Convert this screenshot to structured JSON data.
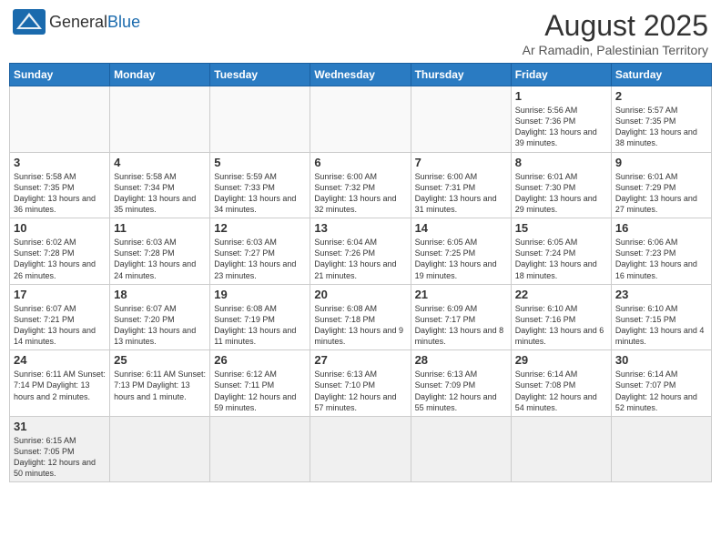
{
  "logo": {
    "text_general": "General",
    "text_blue": "Blue"
  },
  "title": "August 2025",
  "subtitle": "Ar Ramadin, Palestinian Territory",
  "weekdays": [
    "Sunday",
    "Monday",
    "Tuesday",
    "Wednesday",
    "Thursday",
    "Friday",
    "Saturday"
  ],
  "weeks": [
    [
      {
        "day": "",
        "info": ""
      },
      {
        "day": "",
        "info": ""
      },
      {
        "day": "",
        "info": ""
      },
      {
        "day": "",
        "info": ""
      },
      {
        "day": "",
        "info": ""
      },
      {
        "day": "1",
        "info": "Sunrise: 5:56 AM\nSunset: 7:36 PM\nDaylight: 13 hours and 39 minutes."
      },
      {
        "day": "2",
        "info": "Sunrise: 5:57 AM\nSunset: 7:35 PM\nDaylight: 13 hours and 38 minutes."
      }
    ],
    [
      {
        "day": "3",
        "info": "Sunrise: 5:58 AM\nSunset: 7:35 PM\nDaylight: 13 hours and 36 minutes."
      },
      {
        "day": "4",
        "info": "Sunrise: 5:58 AM\nSunset: 7:34 PM\nDaylight: 13 hours and 35 minutes."
      },
      {
        "day": "5",
        "info": "Sunrise: 5:59 AM\nSunset: 7:33 PM\nDaylight: 13 hours and 34 minutes."
      },
      {
        "day": "6",
        "info": "Sunrise: 6:00 AM\nSunset: 7:32 PM\nDaylight: 13 hours and 32 minutes."
      },
      {
        "day": "7",
        "info": "Sunrise: 6:00 AM\nSunset: 7:31 PM\nDaylight: 13 hours and 31 minutes."
      },
      {
        "day": "8",
        "info": "Sunrise: 6:01 AM\nSunset: 7:30 PM\nDaylight: 13 hours and 29 minutes."
      },
      {
        "day": "9",
        "info": "Sunrise: 6:01 AM\nSunset: 7:29 PM\nDaylight: 13 hours and 27 minutes."
      }
    ],
    [
      {
        "day": "10",
        "info": "Sunrise: 6:02 AM\nSunset: 7:28 PM\nDaylight: 13 hours and 26 minutes."
      },
      {
        "day": "11",
        "info": "Sunrise: 6:03 AM\nSunset: 7:28 PM\nDaylight: 13 hours and 24 minutes."
      },
      {
        "day": "12",
        "info": "Sunrise: 6:03 AM\nSunset: 7:27 PM\nDaylight: 13 hours and 23 minutes."
      },
      {
        "day": "13",
        "info": "Sunrise: 6:04 AM\nSunset: 7:26 PM\nDaylight: 13 hours and 21 minutes."
      },
      {
        "day": "14",
        "info": "Sunrise: 6:05 AM\nSunset: 7:25 PM\nDaylight: 13 hours and 19 minutes."
      },
      {
        "day": "15",
        "info": "Sunrise: 6:05 AM\nSunset: 7:24 PM\nDaylight: 13 hours and 18 minutes."
      },
      {
        "day": "16",
        "info": "Sunrise: 6:06 AM\nSunset: 7:23 PM\nDaylight: 13 hours and 16 minutes."
      }
    ],
    [
      {
        "day": "17",
        "info": "Sunrise: 6:07 AM\nSunset: 7:21 PM\nDaylight: 13 hours and 14 minutes."
      },
      {
        "day": "18",
        "info": "Sunrise: 6:07 AM\nSunset: 7:20 PM\nDaylight: 13 hours and 13 minutes."
      },
      {
        "day": "19",
        "info": "Sunrise: 6:08 AM\nSunset: 7:19 PM\nDaylight: 13 hours and 11 minutes."
      },
      {
        "day": "20",
        "info": "Sunrise: 6:08 AM\nSunset: 7:18 PM\nDaylight: 13 hours and 9 minutes."
      },
      {
        "day": "21",
        "info": "Sunrise: 6:09 AM\nSunset: 7:17 PM\nDaylight: 13 hours and 8 minutes."
      },
      {
        "day": "22",
        "info": "Sunrise: 6:10 AM\nSunset: 7:16 PM\nDaylight: 13 hours and 6 minutes."
      },
      {
        "day": "23",
        "info": "Sunrise: 6:10 AM\nSunset: 7:15 PM\nDaylight: 13 hours and 4 minutes."
      }
    ],
    [
      {
        "day": "24",
        "info": "Sunrise: 6:11 AM\nSunset: 7:14 PM\nDaylight: 13 hours and 2 minutes."
      },
      {
        "day": "25",
        "info": "Sunrise: 6:11 AM\nSunset: 7:13 PM\nDaylight: 13 hours and 1 minute."
      },
      {
        "day": "26",
        "info": "Sunrise: 6:12 AM\nSunset: 7:11 PM\nDaylight: 12 hours and 59 minutes."
      },
      {
        "day": "27",
        "info": "Sunrise: 6:13 AM\nSunset: 7:10 PM\nDaylight: 12 hours and 57 minutes."
      },
      {
        "day": "28",
        "info": "Sunrise: 6:13 AM\nSunset: 7:09 PM\nDaylight: 12 hours and 55 minutes."
      },
      {
        "day": "29",
        "info": "Sunrise: 6:14 AM\nSunset: 7:08 PM\nDaylight: 12 hours and 54 minutes."
      },
      {
        "day": "30",
        "info": "Sunrise: 6:14 AM\nSunset: 7:07 PM\nDaylight: 12 hours and 52 minutes."
      }
    ],
    [
      {
        "day": "31",
        "info": "Sunrise: 6:15 AM\nSunset: 7:05 PM\nDaylight: 12 hours and 50 minutes."
      },
      {
        "day": "",
        "info": ""
      },
      {
        "day": "",
        "info": ""
      },
      {
        "day": "",
        "info": ""
      },
      {
        "day": "",
        "info": ""
      },
      {
        "day": "",
        "info": ""
      },
      {
        "day": "",
        "info": ""
      }
    ]
  ]
}
